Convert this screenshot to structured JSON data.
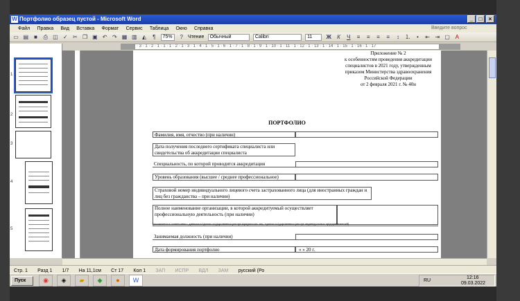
{
  "window": {
    "title": "Портфолио образец пустой - Microsoft Word",
    "min": "_",
    "max": "□",
    "close": "×"
  },
  "menu": [
    "Файл",
    "Правка",
    "Вид",
    "Вставка",
    "Формат",
    "Сервис",
    "Таблица",
    "Окно",
    "Справка"
  ],
  "help_placeholder": "Введите вопрос",
  "toolbar": {
    "zoom": "75%",
    "reading": "Чтение",
    "style": "Обычный",
    "font": "Calibri",
    "size": "11"
  },
  "thumbnails": [
    "1",
    "2",
    "3",
    "4",
    "5"
  ],
  "ruler": "· 3 · 1 · 2 · 1 · 1 · 1 · 2 · 1 · 3 · 1 · 4 · 1 · 5 · 1 · 6 · 1 · 7 · 1 · 8 · 1 · 9 · 1 · 10 · 1 · 11 · 1 · 12 · 1 · 13 · 1 · 14 · 1 · 15 · 1 · 16 · 1 · 17",
  "document": {
    "appendix": [
      "Приложение № 2",
      "к особенностям проведения аккредитации",
      "специалистов в 2021 году, утвержденным",
      "приказом Министерства здравоохранения",
      "Российской Федерации",
      "от 2 февраля 2021 г. № 40н"
    ],
    "title": "ПОРТФОЛИО",
    "rows": [
      "Фамилия, имя, отчество (при наличии)",
      "Дата получения последнего сертификата специалиста или свидетельства об аккредитации специалиста",
      "Специальность, по которой проводится аккредитация",
      "Уровень образования (высшее / среднее профессиональное)",
      "Страховой номер индивидуального лицевого счета застрахованного лица (для иностранных граждан и лиц без гражданства – при наличии)",
      "Полное наименование организации, в которой аккредитуемый осуществляет профессиональную деятельность (при наличии)",
      "Занимаемая должность (при наличии)",
      "Дата формирования портфолио"
    ],
    "note": "(указывается в соответствии с данными в едином государственном реестре юридических лиц / едином государственном реестре индивидуальных предпринимателей)",
    "date_value": "«   »              20   г."
  },
  "status": {
    "page": "Стр. 1",
    "section": "Разд 1",
    "pages": "1/7",
    "pos": "На 11,1см",
    "line": "Ст 17",
    "col": "Кол 1",
    "rec": "ЗАП",
    "trk": "ИСПР",
    "ext": "ВДЛ",
    "ovr": "ЗАМ",
    "lang": "русский (Ро"
  },
  "taskbar": {
    "start": "Пуск",
    "lang": "RU",
    "time": "12:16",
    "date": "09.03.2022"
  }
}
